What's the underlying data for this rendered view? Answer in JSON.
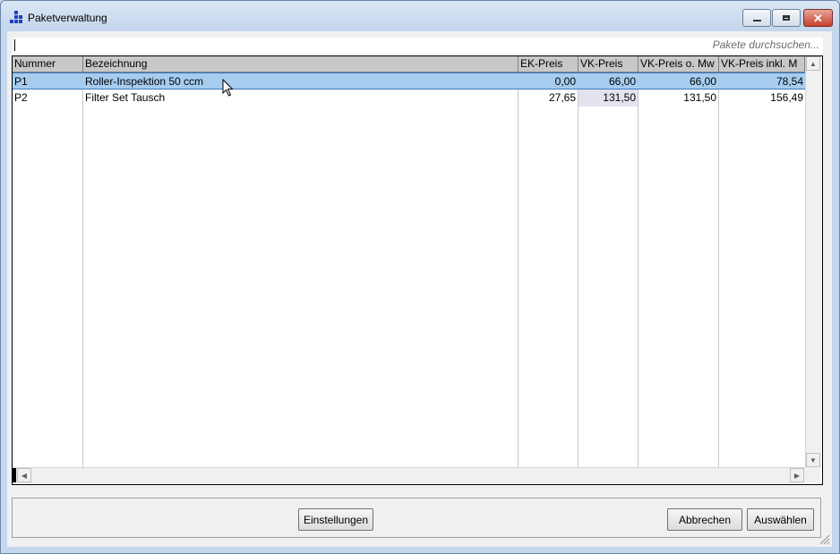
{
  "window": {
    "title": "Paketverwaltung"
  },
  "search": {
    "placeholder": "Pakete durchsuchen..."
  },
  "table": {
    "columns": [
      "Nummer",
      "Bezeichnung",
      "EK-Preis",
      "VK-Preis",
      "VK-Preis o. Mw",
      "VK-Preis inkl. M"
    ],
    "rows": [
      [
        "P1",
        "Roller-Inspektion 50 ccm",
        "0,00",
        "66,00",
        "66,00",
        "78,54"
      ],
      [
        "P2",
        "Filter Set Tausch",
        "27,65",
        "131,50",
        "131,50",
        "156,49"
      ]
    ],
    "selected_row": 0
  },
  "buttons": {
    "settings": "Einstellungen",
    "cancel": "Abbrechen",
    "choose": "Auswählen"
  },
  "icons": {
    "app": "app-grid-icon",
    "minimize": "minimize-icon",
    "maximize": "maximize-icon",
    "close": "close-icon",
    "cursor": "mouse-pointer-icon",
    "resize": "resize-grip-icon"
  },
  "colors": {
    "selection": "#a6cdf0",
    "header": "#c8c8c8",
    "close_button": "#c7402b"
  }
}
